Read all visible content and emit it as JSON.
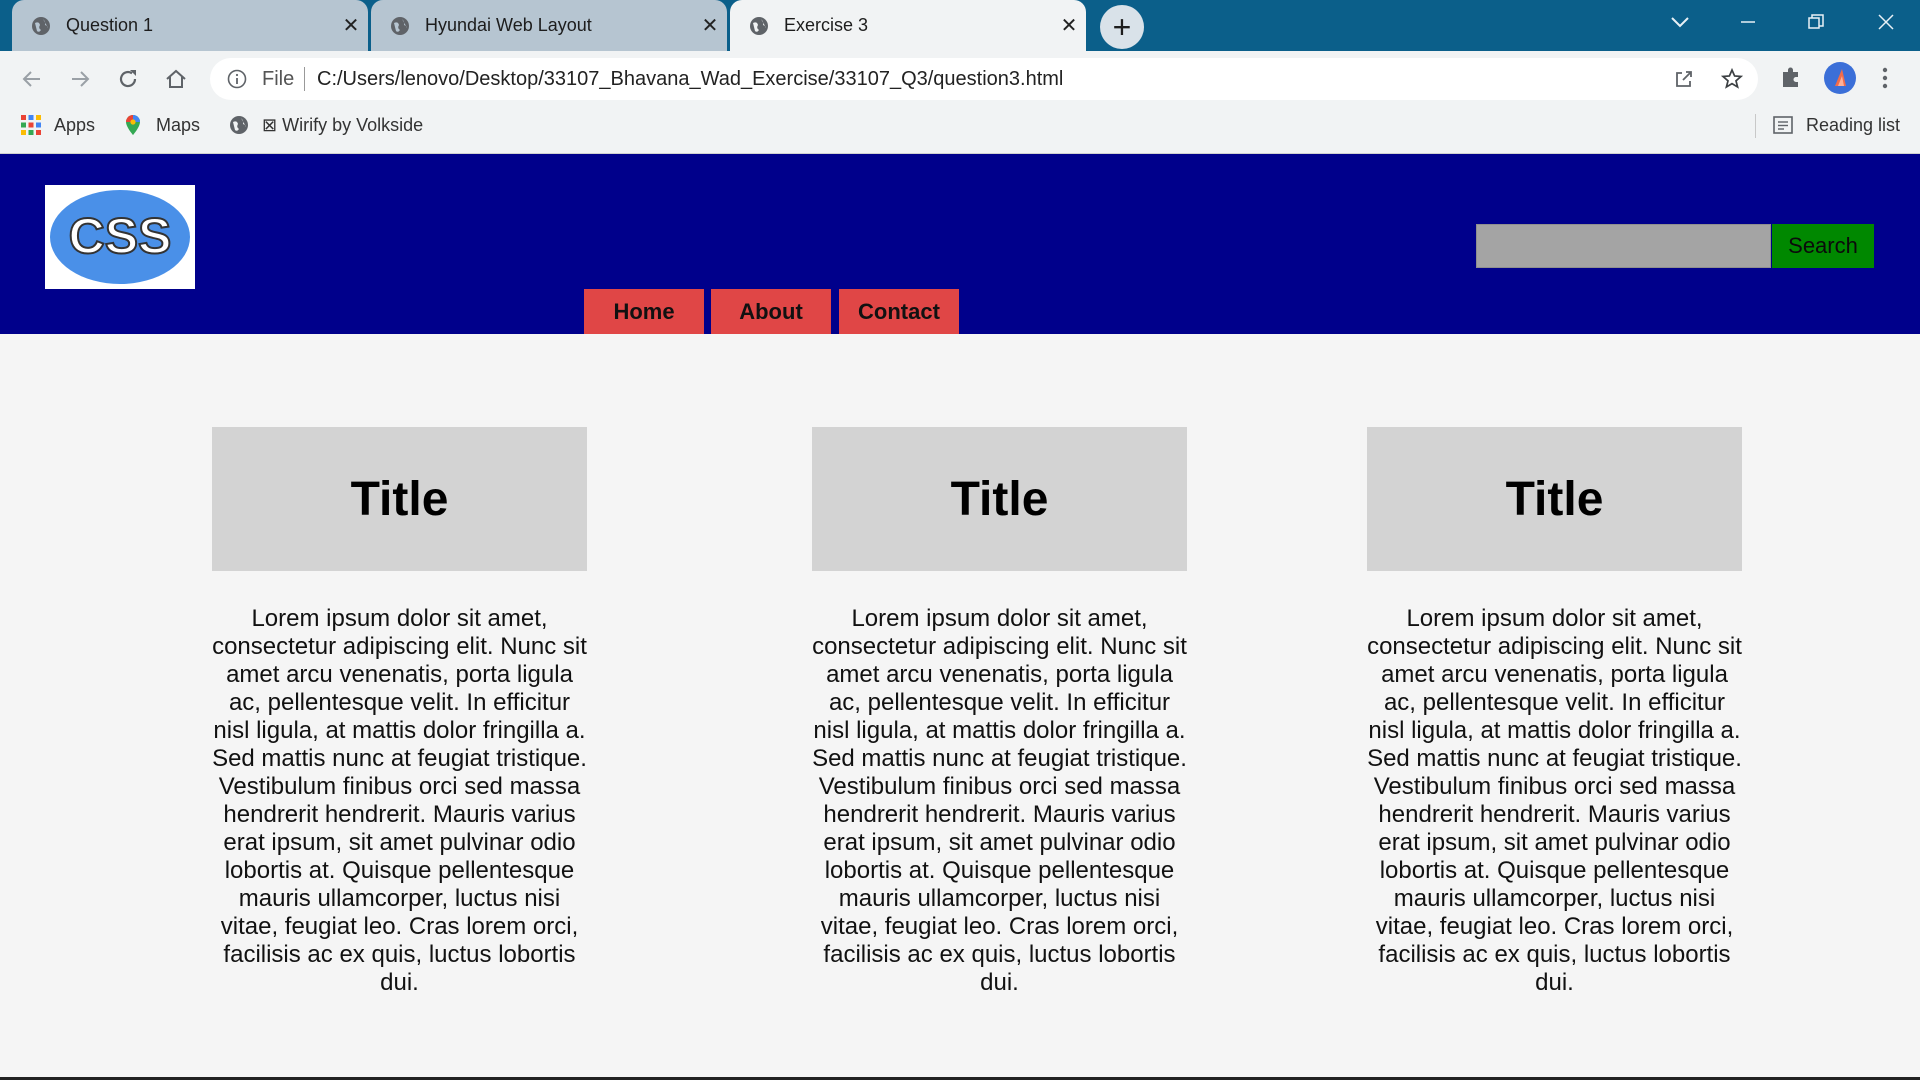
{
  "browser": {
    "tabs": [
      {
        "title": "Question 1"
      },
      {
        "title": "Hyundai Web Layout"
      },
      {
        "title": "Exercise 3"
      }
    ],
    "tab_close_glyph": "✕",
    "new_tab_glyph": "+",
    "address": {
      "scheme_label": "File",
      "url": "C:/Users/lenovo/Desktop/33107_Bhavana_Wad_Exercise/33107_Q3/question3.html"
    },
    "bookmarks": [
      {
        "label": "Apps",
        "icon": "apps-grid-icon"
      },
      {
        "label": "Maps",
        "icon": "maps-pin-icon"
      },
      {
        "label": "⊠ Wirify by Volkside",
        "icon": "globe-icon"
      }
    ],
    "reading_list_label": "Reading list"
  },
  "site": {
    "logo_text": "CSS",
    "search": {
      "placeholder": "",
      "button_label": "Search"
    },
    "nav": [
      {
        "label": "Home"
      },
      {
        "label": "About"
      },
      {
        "label": "Contact"
      }
    ],
    "cards": [
      {
        "title": "Title",
        "text": "Lorem ipsum dolor sit amet, consectetur adipiscing elit. Nunc sit amet arcu venenatis, porta ligula ac, pellentesque velit. In efficitur nisl ligula, at mattis dolor fringilla a. Sed mattis nunc at feugiat tristique. Vestibulum finibus orci sed massa hendrerit hendrerit. Mauris varius erat ipsum, sit amet pulvinar odio lobortis at. Quisque pellentesque mauris ullamcorper, luctus nisi vitae, feugiat leo. Cras lorem orci, facilisis ac ex quis, luctus lobortis dui."
      },
      {
        "title": "Title",
        "text": "Lorem ipsum dolor sit amet, consectetur adipiscing elit. Nunc sit amet arcu venenatis, porta ligula ac, pellentesque velit. In efficitur nisl ligula, at mattis dolor fringilla a. Sed mattis nunc at feugiat tristique. Vestibulum finibus orci sed massa hendrerit hendrerit. Mauris varius erat ipsum, sit amet pulvinar odio lobortis at. Quisque pellentesque mauris ullamcorper, luctus nisi vitae, feugiat leo. Cras lorem orci, facilisis ac ex quis, luctus lobortis dui."
      },
      {
        "title": "Title",
        "text": "Lorem ipsum dolor sit amet, consectetur adipiscing elit. Nunc sit amet arcu venenatis, porta ligula ac, pellentesque velit. In efficitur nisl ligula, at mattis dolor fringilla a. Sed mattis nunc at feugiat tristique. Vestibulum finibus orci sed massa hendrerit hendrerit. Mauris varius erat ipsum, sit amet pulvinar odio lobortis at. Quisque pellentesque mauris ullamcorper, luctus nisi vitae, feugiat leo. Cras lorem orci, facilisis ac ex quis, luctus lobortis dui."
      }
    ]
  },
  "colors": {
    "tabstrip": "#0b5f8a",
    "header_bg": "#00008b",
    "nav_bg": "#e04646",
    "search_button_bg": "#008800",
    "search_input_bg": "#a4a4a4",
    "card_title_bg": "#d3d3d3",
    "page_bg": "#f5f5f5"
  }
}
